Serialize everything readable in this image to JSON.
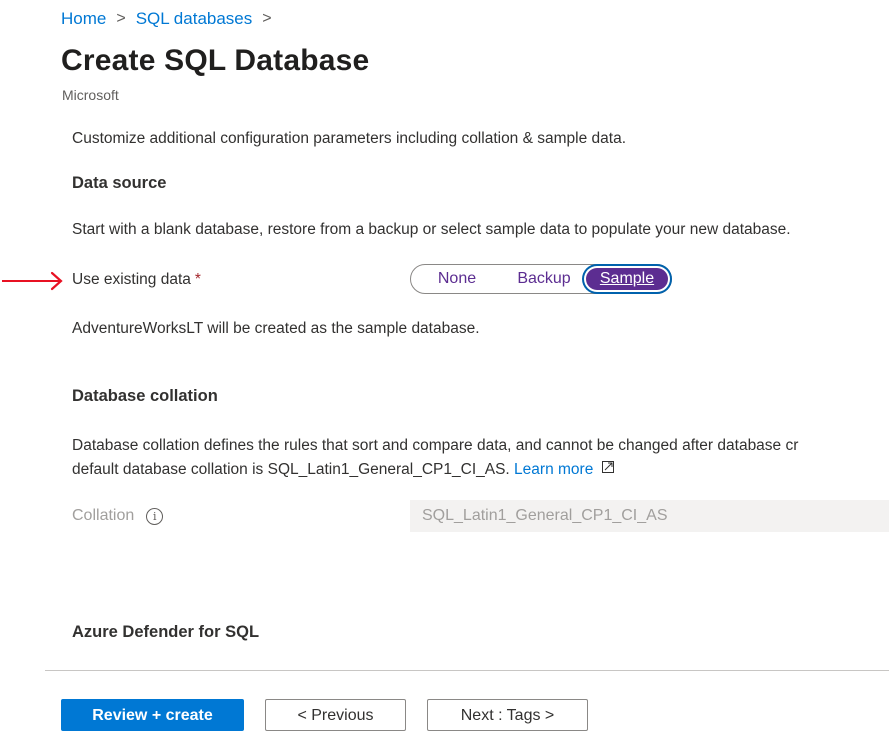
{
  "breadcrumb": {
    "items": [
      "Home",
      "SQL databases"
    ],
    "separator": ">"
  },
  "header": {
    "title": "Create SQL Database",
    "subtitle": "Microsoft"
  },
  "intro": "Customize additional configuration parameters including collation & sample data.",
  "data_source": {
    "heading": "Data source",
    "description": "Start with a blank database, restore from a backup or select sample data to populate your new database.",
    "field_label": "Use existing data",
    "required_marker": "*",
    "options": [
      "None",
      "Backup",
      "Sample"
    ],
    "selected": "Sample",
    "sample_note": "AdventureWorksLT will be created as the sample database."
  },
  "collation": {
    "heading": "Database collation",
    "description_line1": "Database collation defines the rules that sort and compare data, and cannot be changed after database cr",
    "description_line2": "default database collation is SQL_Latin1_General_CP1_CI_AS.",
    "learn_more": "Learn more",
    "field_label": "Collation",
    "info_glyph": "i",
    "value": "SQL_Latin1_General_CP1_CI_AS"
  },
  "defender": {
    "heading": "Azure Defender for SQL"
  },
  "footer": {
    "review_create": "Review + create",
    "previous": "< Previous",
    "next": "Next : Tags >"
  },
  "colors": {
    "accent": "#0078d4",
    "toggle_selected": "#5c2d91",
    "annotation_arrow": "#e81123",
    "required": "#a4262c"
  }
}
